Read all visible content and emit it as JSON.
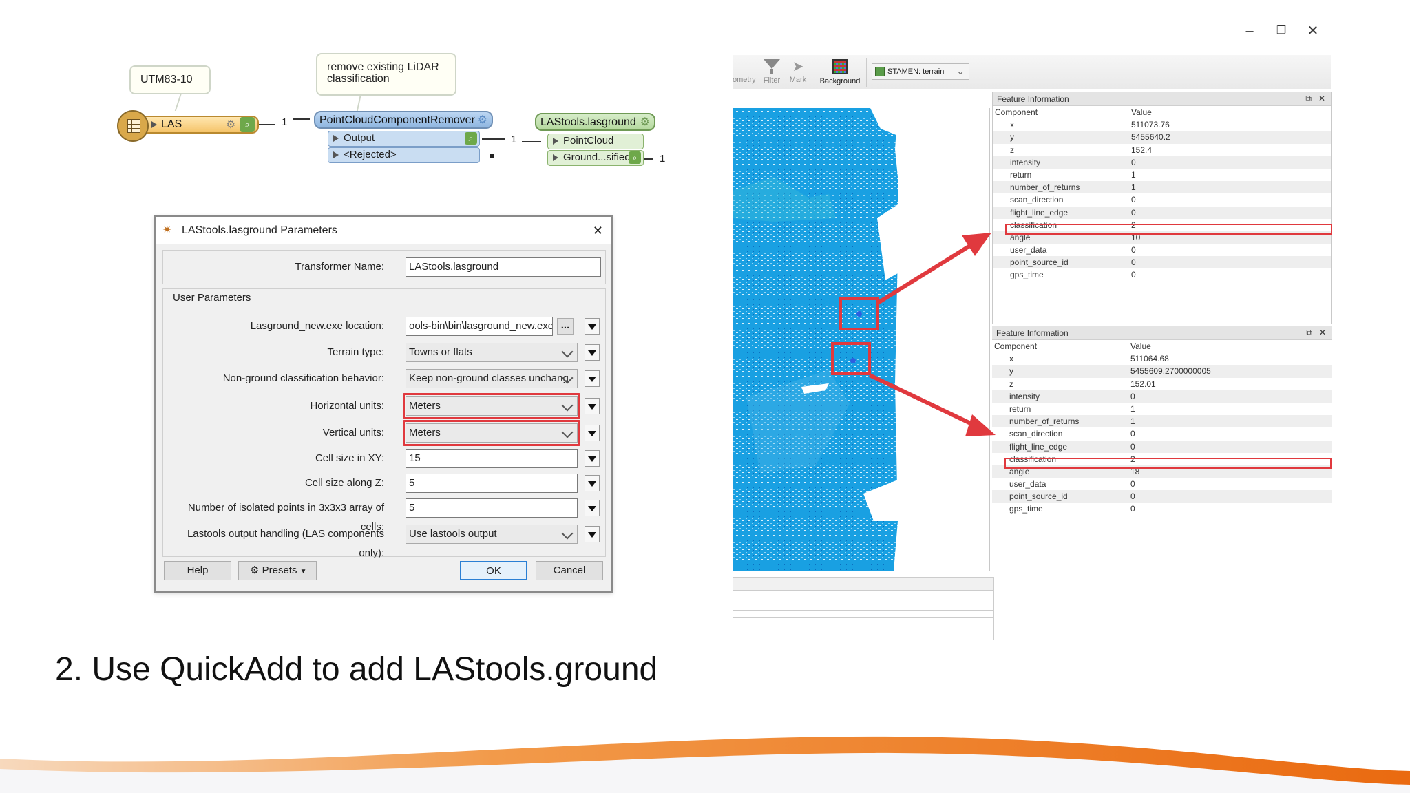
{
  "window": {
    "minimize": "–",
    "restore": "❐",
    "close": "✕"
  },
  "workflow": {
    "callout_coord": "UTM83-10",
    "callout_remove": "remove existing LiDAR classification",
    "reader_label": "LAS",
    "link_count_1": "1",
    "remover_title": "PointCloudComponentRemover",
    "remover_port_output": "Output",
    "remover_port_rejected": "<Rejected>",
    "link_count_2": "1",
    "lasground_title": "LAStools.lasground",
    "lasground_port_in": "PointCloud",
    "lasground_port_out": "Ground...sified",
    "link_count_3": "1"
  },
  "dialog": {
    "title": "LAStools.lasground Parameters",
    "close": "✕",
    "transformer_name_label": "Transformer Name:",
    "transformer_name_value": "LAStools.lasground",
    "group_label": "User Parameters",
    "params": [
      {
        "label": "Lasground_new.exe location:",
        "value": "ools-bin\\bin\\lasground_new.exe"
      },
      {
        "label": "Terrain type:",
        "value": "Towns or flats"
      },
      {
        "label": "Non-ground classification behavior:",
        "value": "Keep non-ground classes unchang"
      },
      {
        "label": "Horizontal units:",
        "value": "Meters"
      },
      {
        "label": "Vertical units:",
        "value": "Meters"
      },
      {
        "label": "Cell size in XY:",
        "value": "15"
      },
      {
        "label": "Cell size along Z:",
        "value": "5"
      },
      {
        "label": "Number of isolated points in 3x3x3 array of cells:",
        "value": "5"
      },
      {
        "label": "Lastools output handling (LAS components only):",
        "value": "Use lastools output"
      }
    ],
    "browse": "...",
    "help": "Help",
    "presets": "Presets",
    "ok": "OK",
    "cancel": "Cancel"
  },
  "viewer": {
    "toolbar": {
      "geometry": "ometry",
      "filter": "Filter",
      "mark": "Mark",
      "background": "Background",
      "basemap": "STAMEN: terrain"
    },
    "panel1": {
      "title": "Feature Information",
      "col_component": "Component",
      "col_value": "Value",
      "rows": [
        {
          "k": "x",
          "v": "511073.76"
        },
        {
          "k": "y",
          "v": "5455640.2"
        },
        {
          "k": "z",
          "v": "152.4"
        },
        {
          "k": "intensity",
          "v": "0"
        },
        {
          "k": "return",
          "v": "1"
        },
        {
          "k": "number_of_returns",
          "v": "1"
        },
        {
          "k": "scan_direction",
          "v": "0"
        },
        {
          "k": "flight_line_edge",
          "v": "0"
        },
        {
          "k": "classification",
          "v": "2"
        },
        {
          "k": "angle",
          "v": "10"
        },
        {
          "k": "user_data",
          "v": "0"
        },
        {
          "k": "point_source_id",
          "v": "0"
        },
        {
          "k": "gps_time",
          "v": "0"
        }
      ]
    },
    "panel2": {
      "title": "Feature Information",
      "col_component": "Component",
      "col_value": "Value",
      "rows": [
        {
          "k": "x",
          "v": "511064.68"
        },
        {
          "k": "y",
          "v": "5455609.2700000005"
        },
        {
          "k": "z",
          "v": "152.01"
        },
        {
          "k": "intensity",
          "v": "0"
        },
        {
          "k": "return",
          "v": "1"
        },
        {
          "k": "number_of_returns",
          "v": "1"
        },
        {
          "k": "scan_direction",
          "v": "0"
        },
        {
          "k": "flight_line_edge",
          "v": "0"
        },
        {
          "k": "classification",
          "v": "2"
        },
        {
          "k": "angle",
          "v": "18"
        },
        {
          "k": "user_data",
          "v": "0"
        },
        {
          "k": "point_source_id",
          "v": "0"
        },
        {
          "k": "gps_time",
          "v": "0"
        }
      ]
    }
  },
  "caption": "2. Use QuickAdd to add LAStools.ground",
  "colors": {
    "accent_red": "#e0393e",
    "point_cloud": "#1a9fe0",
    "wave_orange": "#f07c1a"
  }
}
